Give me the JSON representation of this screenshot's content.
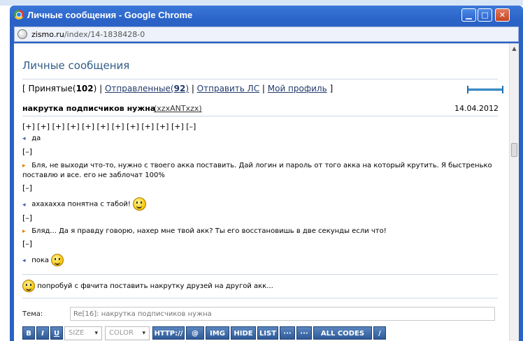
{
  "window": {
    "title": "Личные сообщения - Google Chrome",
    "url_host": "zismo.ru",
    "url_path": "/index/14-1838428-0",
    "minimize": "▁",
    "maximize": "□",
    "close": "✕"
  },
  "page": {
    "title": "Личные сообщения",
    "tabs": {
      "open": "[",
      "inbox_label": "Принятые",
      "inbox_count": "102",
      "sent_label": "Отправленные",
      "sent_count": "92",
      "send_label": "Отправить ЛС",
      "profile_label": "Мой профиль",
      "close": "]"
    }
  },
  "thread": {
    "subject": "накрутка подписчиков нужна",
    "author": "xzxANTxzx",
    "date": "14.04.2012",
    "expanders": "[+] [+] [+] [+] [+] [+] [+] [+] [+] [+] [+] [–]",
    "collapse": "[–]",
    "messages": [
      {
        "dir": "in",
        "text": "да"
      },
      {
        "dir": "out",
        "text": "Бля, не выходи что-то, нужно с твоего акка поставить. Дай логин и пароль от того акка на который крутить. Я быстренько поставлю и все. его не заблочат 100%"
      },
      {
        "dir": "in",
        "text": "ахахахха понятна с табой!"
      },
      {
        "dir": "out",
        "text": "Бляд... Да я правду говорю, нахер мне твой акк? Ты его восстановишь в две секунды если что!"
      },
      {
        "dir": "in",
        "text": "пока"
      }
    ],
    "last_message": "попробуй с фвчита поставить накрутку друзей на другой акк..."
  },
  "reply": {
    "label": "Тема:",
    "placeholder": "Re[16]: накрутка подписчиков нужна",
    "toolbar": {
      "bold": "B",
      "italic": "I",
      "underline": "U",
      "size": "SIZE",
      "color": "COLOR",
      "http": "HTTP://",
      "at": "@",
      "img": "IMG",
      "hide": "HIDE",
      "list": "LIST",
      "more1": "···",
      "more2": "···",
      "all_codes": "ALL CODES",
      "slash": "/"
    }
  },
  "icons": {
    "window": "chrome-logo-icon",
    "address": "globe-icon",
    "smiley": "smiley-icon"
  }
}
